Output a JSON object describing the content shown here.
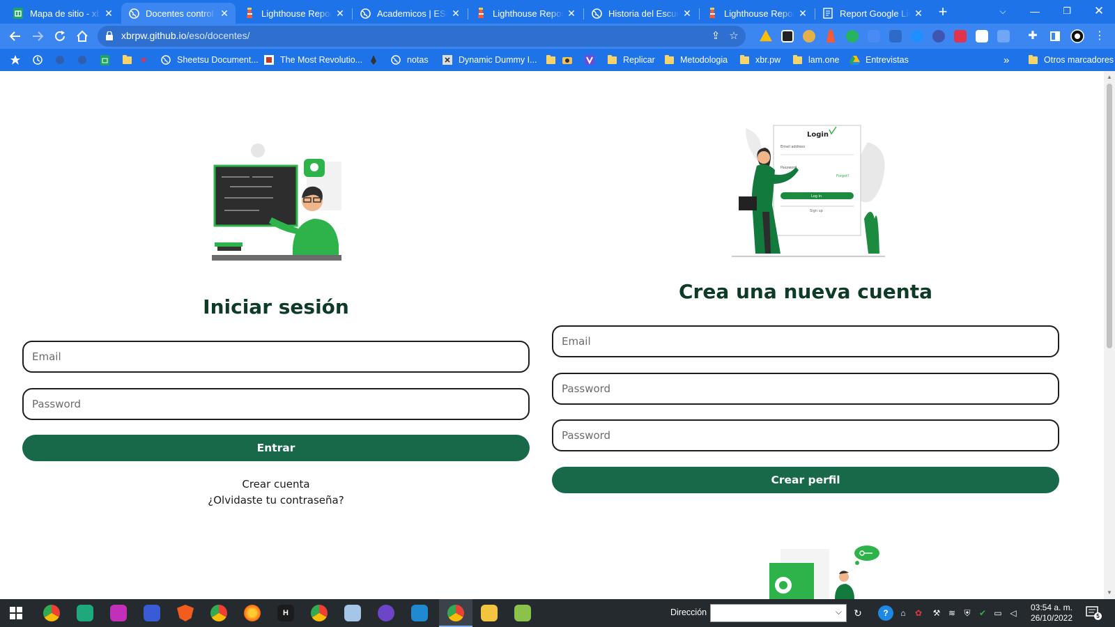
{
  "browser": {
    "tabs": [
      {
        "title": "Mapa de sitio - xbr",
        "active": false,
        "favicon": "sheets-icon"
      },
      {
        "title": "Docentes control",
        "active": true,
        "favicon": "globe-icon"
      },
      {
        "title": "Lighthouse Report",
        "active": false,
        "favicon": "lighthouse-icon"
      },
      {
        "title": "Academicos | ESO",
        "active": false,
        "favicon": "globe-icon"
      },
      {
        "title": "Lighthouse Report",
        "active": false,
        "favicon": "lighthouse-icon"
      },
      {
        "title": "Historia del Escudo",
        "active": false,
        "favicon": "globe-icon"
      },
      {
        "title": "Lighthouse Report",
        "active": false,
        "favicon": "lighthouse-icon"
      },
      {
        "title": "Report Google Lighthouse",
        "active": false,
        "favicon": "report-icon"
      }
    ],
    "address": {
      "host": "xbrpw.github.io",
      "path": "/eso/docentes/"
    },
    "bookmarks": [
      {
        "label": "Sheetsu Document...",
        "icon": "globe-icon"
      },
      {
        "label": "The Most Revolutio...",
        "icon": "site-icon"
      },
      {
        "label": "notas",
        "icon": "globe-icon"
      },
      {
        "label": "Dynamic Dummy I...",
        "icon": "x-icon"
      },
      {
        "label": "Replicar",
        "icon": "folder-icon"
      },
      {
        "label": "Metodologia",
        "icon": "folder-icon"
      },
      {
        "label": "xbr.pw",
        "icon": "folder-icon"
      },
      {
        "label": "lam.one",
        "icon": "folder-icon"
      },
      {
        "label": "Entrevistas",
        "icon": "drive-icon"
      }
    ],
    "overflow_label": "»",
    "other_bookmarks": "Otros marcadores"
  },
  "login": {
    "title": "Iniciar sesión",
    "email_placeholder": "Email",
    "password_placeholder": "Password",
    "submit_label": "Entrar",
    "create_account_link": "Crear cuenta",
    "forgot_link": "¿Olvidaste tu contraseña?"
  },
  "register": {
    "title": "Crea una nueva cuenta",
    "email_placeholder": "Email",
    "password_placeholder": "Password",
    "confirm_placeholder": "Password",
    "submit_label": "Crear perfil"
  },
  "illustration_login": {
    "title": "Login",
    "email_label": "Email address",
    "password_label": "Password",
    "forgot_label": "Forgot?",
    "login_button": "Log in",
    "signup_link": "Sign up"
  },
  "taskbar": {
    "address_label": "Dirección",
    "time": "03:54 a. m.",
    "date": "26/10/2022",
    "notifications": "5"
  },
  "colors": {
    "accent": "#17694a",
    "heading": "#0e3b26",
    "chrome_blue": "#1f73e8",
    "illustration_green": "#2db34a"
  }
}
